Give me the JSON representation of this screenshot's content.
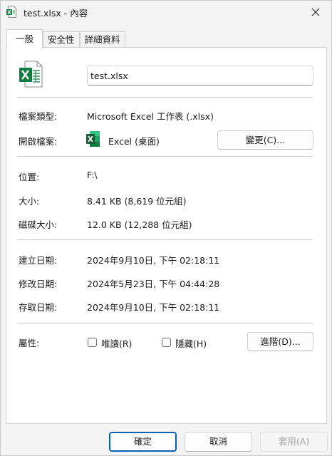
{
  "window": {
    "title": "test.xlsx - 內容",
    "close_icon": "close-icon"
  },
  "tabs": [
    {
      "label": "一般",
      "active": true
    },
    {
      "label": "安全性",
      "active": false
    },
    {
      "label": "詳細資料",
      "active": false
    }
  ],
  "general": {
    "file_icon": "excel-file-icon",
    "file_name": "test.xlsx",
    "file_type_label": "檔案類型:",
    "file_type_value": "Microsoft Excel 工作表 (.xlsx)",
    "opens_with_label": "開啟檔案:",
    "opens_with_app": "Excel (桌面)",
    "change_button": "變更(C)...",
    "location_label": "位置:",
    "location_value": "F:\\",
    "size_label": "大小:",
    "size_value": "8.41 KB (8,619 位元組)",
    "size_on_disk_label": "磁碟大小:",
    "size_on_disk_value": "12.0 KB (12,288 位元組)",
    "created_label": "建立日期:",
    "created_value": "2024年9月10日, 下午 02:18:11",
    "modified_label": "修改日期:",
    "modified_value": "2024年5月23日, 下午 04:44:28",
    "accessed_label": "存取日期:",
    "accessed_value": "2024年9月10日, 下午 02:18:11",
    "attributes_label": "屬性:",
    "readonly_label": "唯讀(R)",
    "readonly_checked": false,
    "hidden_label": "隱藏(H)",
    "hidden_checked": false,
    "advanced_button": "進階(D)..."
  },
  "footer": {
    "ok": "確定",
    "cancel": "取消",
    "apply": "套用(A)"
  },
  "colors": {
    "excel_green": "#107c41",
    "accent_blue": "#005fb8"
  }
}
